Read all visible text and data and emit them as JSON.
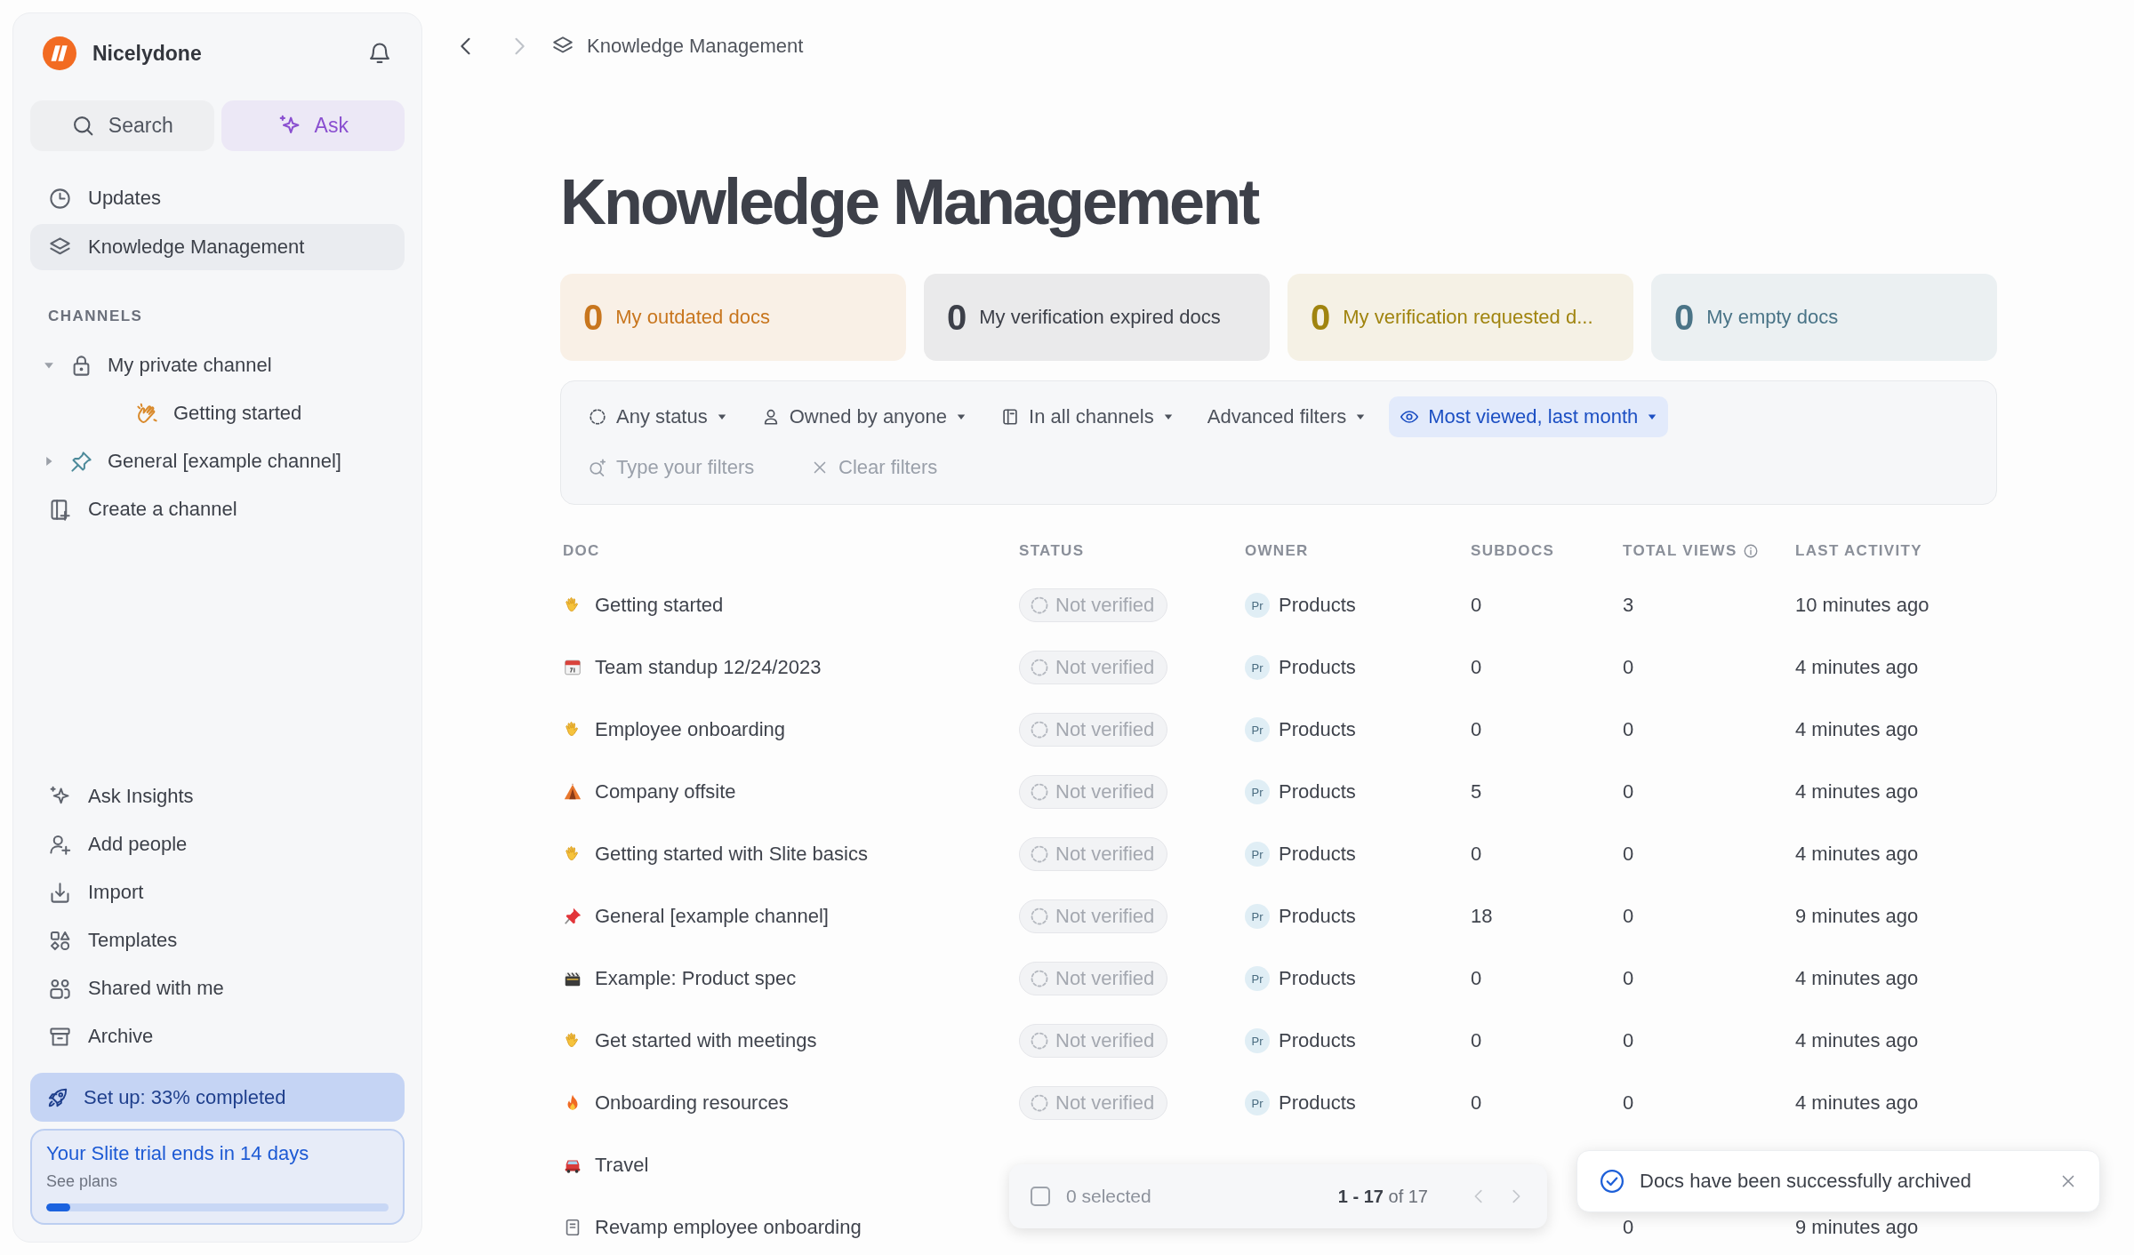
{
  "sidebar": {
    "workspace": "Nicelydone",
    "search_button": "Search",
    "ask_button": "Ask",
    "nav": [
      {
        "label": "Updates",
        "selected": false
      },
      {
        "label": "Knowledge Management",
        "selected": true
      }
    ],
    "channels_heading": "CHANNELS",
    "channels": [
      {
        "label": "My private channel",
        "expanded": true,
        "children": [
          {
            "label": "Getting started"
          }
        ]
      },
      {
        "label": "General [example channel]",
        "expanded": false
      }
    ],
    "create_channel": "Create a channel",
    "bottom_nav": [
      {
        "label": "Ask Insights"
      },
      {
        "label": "Add people"
      },
      {
        "label": "Import"
      },
      {
        "label": "Templates"
      },
      {
        "label": "Shared with me"
      },
      {
        "label": "Archive"
      }
    ],
    "setup": "Set up: 33% completed",
    "trial": {
      "title": "Your Slite trial ends in 14 days",
      "link": "See plans",
      "level": 0.07
    }
  },
  "toolbar": {
    "breadcrumb": "Knowledge Management"
  },
  "page": {
    "title": "Knowledge Management",
    "stat_cards": [
      {
        "count": "0",
        "label": "My outdated docs",
        "color": "#c8761e"
      },
      {
        "count": "0",
        "label": "My verification expired docs",
        "color": "#3d4049"
      },
      {
        "count": "0",
        "label": "My verification requested d...",
        "color": "#a0840f"
      },
      {
        "count": "0",
        "label": "My empty docs",
        "color": "#4a7487"
      }
    ],
    "filters": [
      {
        "label": "Any status",
        "selected": false
      },
      {
        "label": "Owned by anyone",
        "selected": false
      },
      {
        "label": "In all channels",
        "selected": false
      },
      {
        "label": "Advanced filters",
        "selected": false
      },
      {
        "label": "Most viewed, last month",
        "selected": true
      }
    ],
    "filter_input": {
      "placeholder": "Type your filters"
    },
    "clear_filters": "Clear filters",
    "table": {
      "columns": [
        "DOC",
        "STATUS",
        "OWNER",
        "SUBDOCS",
        "TOTAL VIEWS",
        "LAST ACTIVITY"
      ],
      "rows": [
        {
          "kind": "wave",
          "doc": "Getting started",
          "status": "Not verified",
          "owner_initials": "Pr",
          "owner": "Products",
          "subdocs": "0",
          "total_views": "3",
          "last_activity": "10 minutes ago"
        },
        {
          "kind": "calendar",
          "doc": "Team standup 12/24/2023",
          "status": "Not verified",
          "owner_initials": "Pr",
          "owner": "Products",
          "subdocs": "0",
          "total_views": "0",
          "last_activity": "4 minutes ago"
        },
        {
          "kind": "wave",
          "doc": "Employee onboarding",
          "status": "Not verified",
          "owner_initials": "Pr",
          "owner": "Products",
          "subdocs": "0",
          "total_views": "0",
          "last_activity": "4 minutes ago"
        },
        {
          "kind": "tent",
          "doc": "Company offsite",
          "status": "Not verified",
          "owner_initials": "Pr",
          "owner": "Products",
          "subdocs": "5",
          "total_views": "0",
          "last_activity": "4 minutes ago"
        },
        {
          "kind": "wave",
          "doc": "Getting started with Slite basics",
          "status": "Not verified",
          "owner_initials": "Pr",
          "owner": "Products",
          "subdocs": "0",
          "total_views": "0",
          "last_activity": "4 minutes ago"
        },
        {
          "kind": "pin",
          "doc": "General [example channel]",
          "status": "Not verified",
          "owner_initials": "Pr",
          "owner": "Products",
          "subdocs": "18",
          "total_views": "0",
          "last_activity": "9 minutes ago"
        },
        {
          "kind": "clapper",
          "doc": "Example: Product spec",
          "status": "Not verified",
          "owner_initials": "Pr",
          "owner": "Products",
          "subdocs": "0",
          "total_views": "0",
          "last_activity": "4 minutes ago"
        },
        {
          "kind": "wave",
          "doc": "Get started with meetings",
          "status": "Not verified",
          "owner_initials": "Pr",
          "owner": "Products",
          "subdocs": "0",
          "total_views": "0",
          "last_activity": "4 minutes ago"
        },
        {
          "kind": "fire",
          "doc": "Onboarding resources",
          "status": "Not verified",
          "owner_initials": "Pr",
          "owner": "Products",
          "subdocs": "0",
          "total_views": "0",
          "last_activity": "4 minutes ago"
        },
        {
          "kind": "car",
          "doc": "Travel"
        },
        {
          "kind": "page",
          "doc": "Revamp employee onboarding",
          "total_views": "0",
          "last_activity": "9 minutes ago"
        }
      ]
    }
  },
  "selection_bar": {
    "checked": false,
    "selected": "0 selected",
    "range": "**1 - 17** of 17"
  },
  "toast": {
    "message": "Docs have been successfully archived"
  }
}
